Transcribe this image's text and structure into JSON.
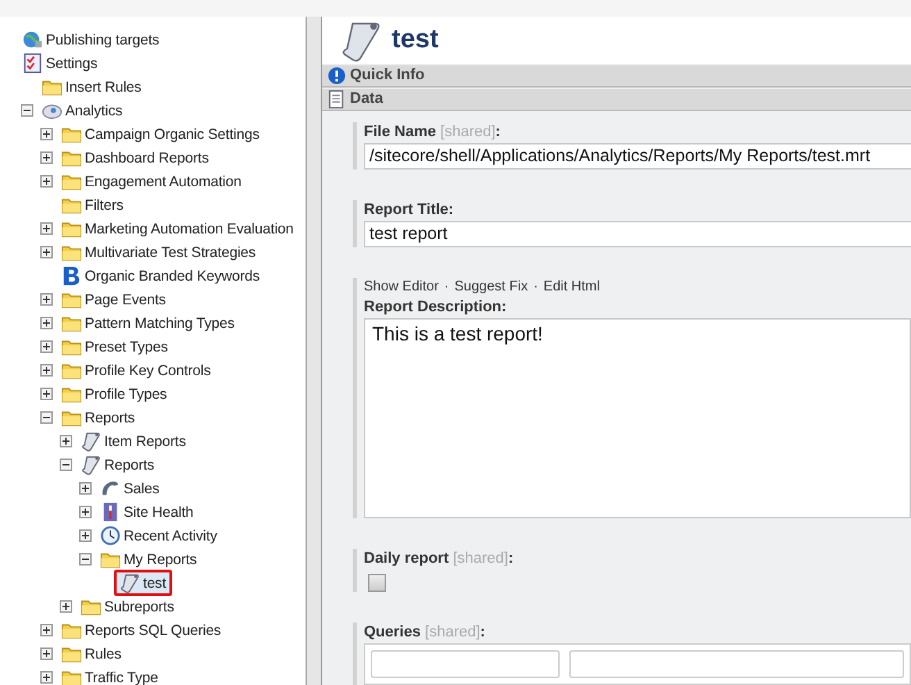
{
  "tree": [
    {
      "label": "Publishing targets",
      "kind": "globe",
      "selected": false
    },
    {
      "label": "Settings",
      "kind": "checklist",
      "selected": false,
      "children": [
        {
          "label": "Insert Rules",
          "kind": "folder",
          "selected": false
        },
        {
          "label": "Analytics",
          "kind": "analytics",
          "selected": false,
          "expanded": true,
          "children": [
            {
              "label": "Campaign Organic Settings",
              "kind": "folder",
              "selected": false,
              "expanded": false
            },
            {
              "label": "Dashboard Reports",
              "kind": "folder",
              "selected": false,
              "expanded": false
            },
            {
              "label": "Engagement Automation",
              "kind": "folder",
              "selected": false,
              "expanded": false
            },
            {
              "label": "Filters",
              "kind": "folder",
              "selected": false
            },
            {
              "label": "Marketing Automation Evaluation",
              "kind": "folder",
              "selected": false,
              "expanded": false
            },
            {
              "label": "Multivariate Test Strategies",
              "kind": "folder",
              "selected": false,
              "expanded": false
            },
            {
              "label": "Organic Branded Keywords",
              "kind": "letter-b",
              "selected": false
            },
            {
              "label": "Page Events",
              "kind": "folder",
              "selected": false,
              "expanded": false
            },
            {
              "label": "Pattern Matching Types",
              "kind": "folder",
              "selected": false,
              "expanded": false
            },
            {
              "label": "Preset Types",
              "kind": "folder",
              "selected": false,
              "expanded": false
            },
            {
              "label": "Profile Key Controls",
              "kind": "folder",
              "selected": false,
              "expanded": false
            },
            {
              "label": "Profile Types",
              "kind": "folder",
              "selected": false,
              "expanded": false
            },
            {
              "label": "Reports",
              "kind": "folder",
              "selected": false,
              "expanded": true,
              "children": [
                {
                  "label": "Item Reports",
                  "kind": "scroll",
                  "selected": false,
                  "expanded": false
                },
                {
                  "label": "Reports",
                  "kind": "scroll",
                  "selected": false,
                  "expanded": true,
                  "children": [
                    {
                      "label": "Sales",
                      "kind": "phone",
                      "selected": false,
                      "expanded": false
                    },
                    {
                      "label": "Site Health",
                      "kind": "thermometer",
                      "selected": false,
                      "expanded": false
                    },
                    {
                      "label": "Recent Activity",
                      "kind": "clock",
                      "selected": false,
                      "expanded": false
                    },
                    {
                      "label": "My Reports",
                      "kind": "folder",
                      "selected": false,
                      "expanded": true,
                      "children": [
                        {
                          "label": "test",
                          "kind": "scroll",
                          "selected": true
                        }
                      ]
                    }
                  ]
                },
                {
                  "label": "Subreports",
                  "kind": "folder",
                  "selected": false,
                  "expanded": false
                }
              ]
            },
            {
              "label": "Reports SQL Queries",
              "kind": "folder",
              "selected": false,
              "expanded": false
            },
            {
              "label": "Rules",
              "kind": "folder",
              "selected": false,
              "expanded": false
            },
            {
              "label": "Traffic Type",
              "kind": "folder",
              "selected": false,
              "expanded": false
            }
          ]
        }
      ]
    }
  ],
  "item": {
    "title": "test"
  },
  "sections": [
    {
      "label": "Quick Info",
      "kind": "info"
    },
    {
      "label": "Data",
      "kind": "document"
    }
  ],
  "fields": [
    {
      "kind": "text",
      "label": "File Name",
      "tag": "[shared]",
      "suffix": ":",
      "value": "/sitecore/shell/Applications/Analytics/Reports/My Reports/test.mrt"
    },
    {
      "kind": "text",
      "label": "Report Title:",
      "value": "test report"
    },
    {
      "kind": "richtext",
      "links": [
        "Show Editor",
        "Suggest Fix",
        "Edit Html"
      ],
      "separator": "·",
      "label": "Report Description:",
      "value": "This is a test report!"
    },
    {
      "kind": "checkbox",
      "label": "Daily report",
      "tag": "[shared]",
      "suffix": ":",
      "checked": false
    },
    {
      "kind": "queries",
      "label": "Queries",
      "tag": "[shared]",
      "suffix": ":"
    }
  ]
}
